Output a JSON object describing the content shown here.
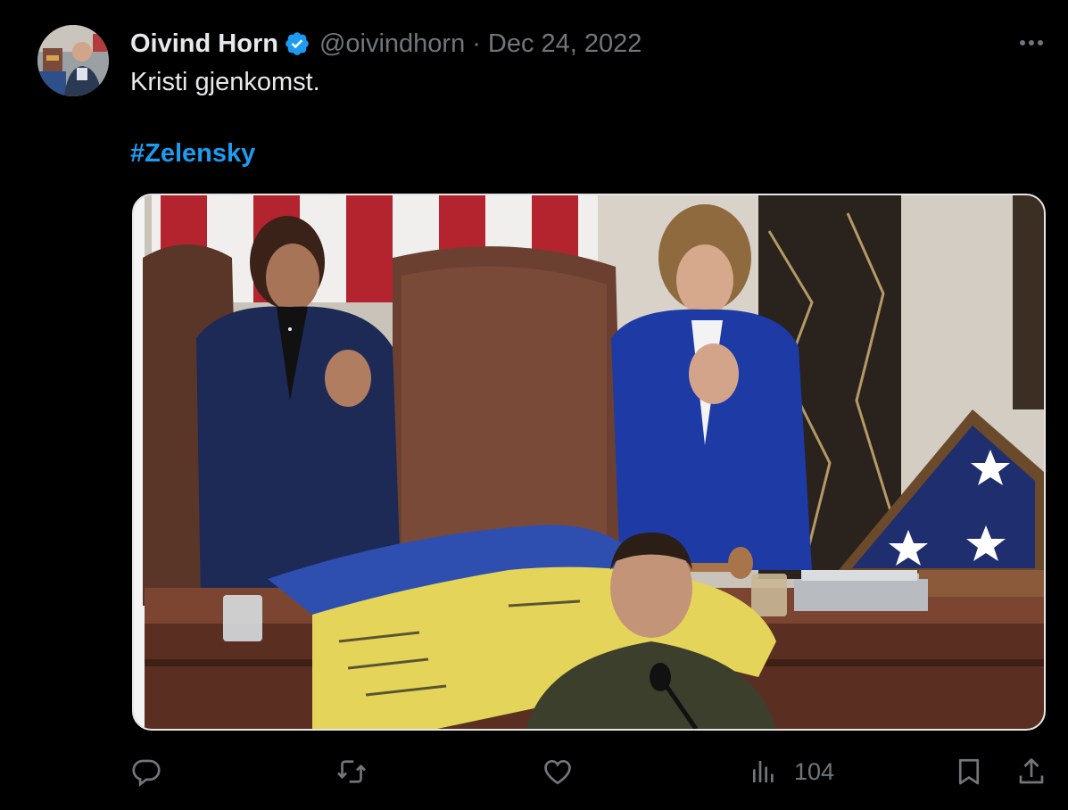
{
  "tweet": {
    "author": {
      "display_name": "Oivind Horn",
      "handle": "@oivindhorn",
      "verified": true,
      "avatar_icon": "profile-photo"
    },
    "separator": "·",
    "date": "Dec 24, 2022",
    "text_line_1": "Kristi gjenkomst.",
    "hashtag": "#Zelensky",
    "media": {
      "type": "photo",
      "icon": "photo-image"
    },
    "actions": {
      "reply_icon": "reply-icon",
      "retweet_icon": "retweet-icon",
      "like_icon": "heart-icon",
      "views_icon": "views-chart-icon",
      "views_count": "104",
      "bookmark_icon": "bookmark-icon",
      "share_icon": "share-icon"
    },
    "more_icon": "more-horizontal-icon"
  },
  "colors": {
    "background": "#000000",
    "text_primary": "#e7e9ea",
    "text_secondary": "#71767b",
    "accent": "#1d9bf0"
  }
}
